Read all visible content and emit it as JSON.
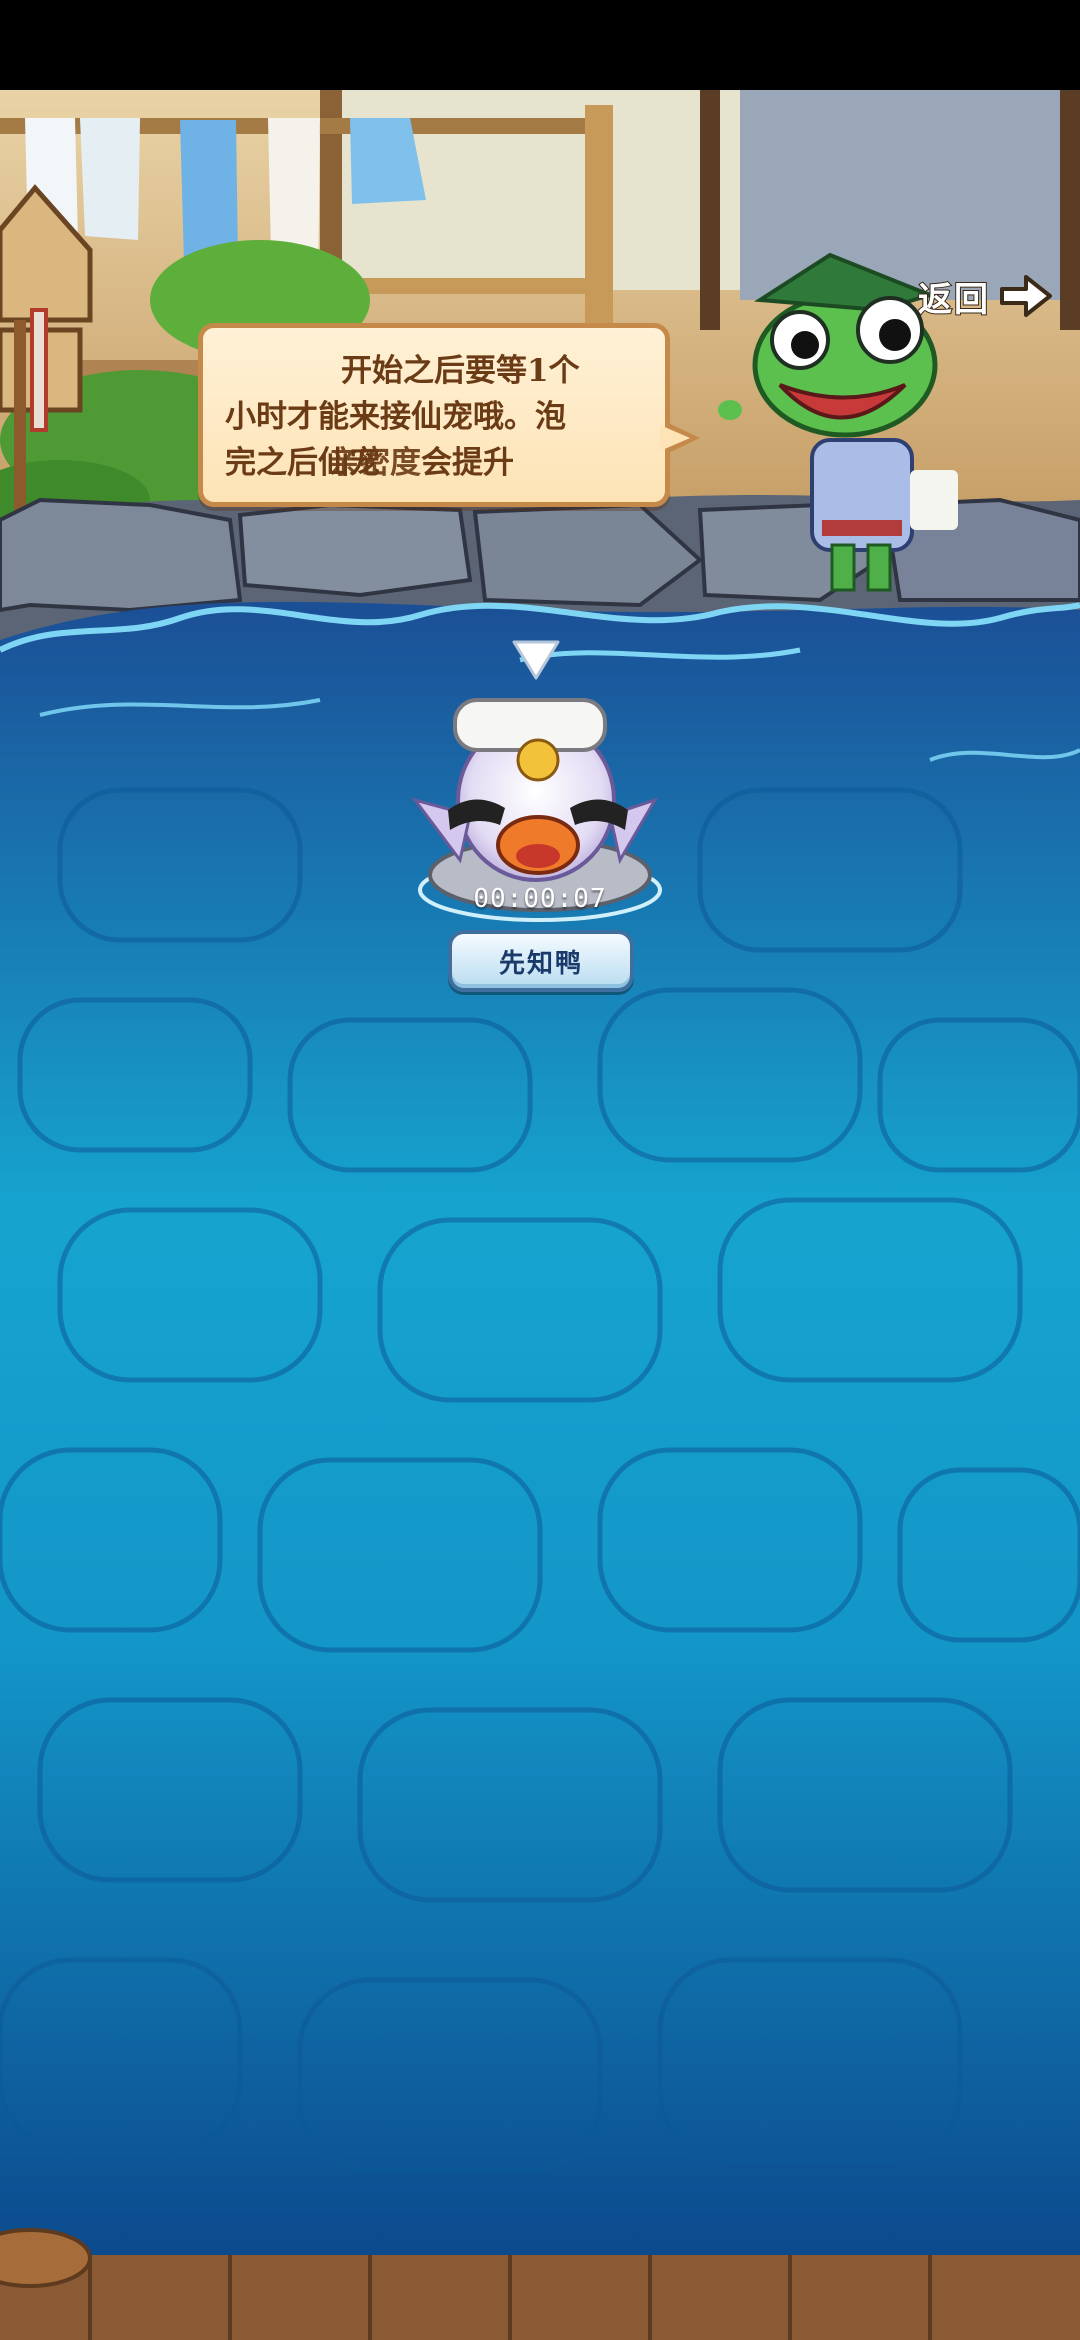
{
  "header": {
    "back_label": "返回"
  },
  "dialog": {
    "line1": "开始之后要等1个",
    "line2": "小时才能来接仙宠哦。泡",
    "line3": "完之后仙宠",
    "line3_overlap": "亲密度",
    "line3_end": "会提升"
  },
  "pet": {
    "timer": "00:00:07",
    "name": "先知鸭"
  },
  "icons": [
    "back-arrow-icon",
    "selection-marker-icon"
  ]
}
